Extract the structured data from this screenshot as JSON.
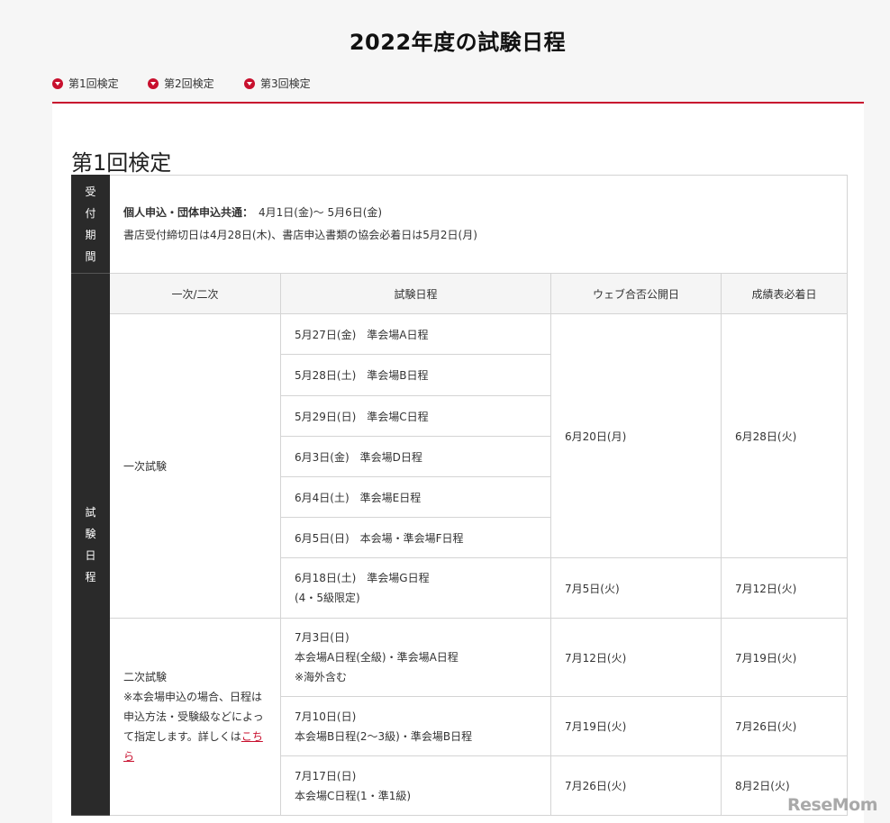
{
  "page": {
    "title": "2022年度の試験日程"
  },
  "anchor_nav": [
    {
      "label": "第1回検定"
    },
    {
      "label": "第2回検定"
    },
    {
      "label": "第3回検定"
    }
  ],
  "section": {
    "heading": "第1回検定"
  },
  "table": {
    "reception": {
      "side_label": "受付期間",
      "line1_label": "個人申込・団体申込共通：",
      "line1_value": "　4月1日(金)〜 5月6日(金)",
      "line2": "書店受付締切日は4月28日(木)、書店申込書類の協会必着日は5月2日(月)"
    },
    "schedule_side_label": "試験日程",
    "headers": [
      "一次/二次",
      "試験日程",
      "ウェブ合否公開日",
      "成績表必着日"
    ],
    "first_round": {
      "label": "一次試験",
      "dates": [
        "5月27日(金)　準会場A日程",
        "5月28日(土)　準会場B日程",
        "5月29日(日)　準会場C日程",
        "6月3日(金)　準会場D日程",
        "6月4日(土)　準会場E日程",
        "6月5日(日)　本会場・準会場F日程"
      ],
      "web_date": "6月20日(月)",
      "report_date": "6月28日(火)",
      "extra": {
        "line1": "6月18日(土)　準会場G日程",
        "line2": "(4・5級限定)",
        "web_date": "7月5日(火)",
        "report_date": "7月12日(火)"
      }
    },
    "second_round": {
      "label": "二次試験",
      "note": "※本会場申込の場合、日程は申込方法・受験級などによって指定します。詳しくは",
      "link": "こちら",
      "rows": [
        {
          "line1": "7月3日(日)",
          "line2": "本会場A日程(全級)・準会場A日程",
          "line3": "※海外含む",
          "web_date": "7月12日(火)",
          "report_date": "7月19日(火)"
        },
        {
          "line1": "7月10日(日)",
          "line2": "本会場B日程(2〜3級)・準会場B日程",
          "web_date": "7月19日(火)",
          "report_date": "7月26日(火)"
        },
        {
          "line1": "7月17日(日)",
          "line2": "本会場C日程(1・準1級)",
          "web_date": "7月26日(火)",
          "report_date": "8月2日(火)"
        }
      ]
    }
  },
  "watermark": {
    "text": "ReseMom"
  }
}
